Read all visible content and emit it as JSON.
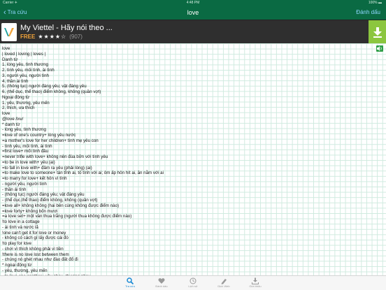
{
  "status_bar": {
    "carrier": "Carrier ✈",
    "time": "4:48 PM",
    "battery": "100% ▬"
  },
  "nav": {
    "back_label": "Tra cứu",
    "title": "love",
    "right_label": "Đánh dấu"
  },
  "ad": {
    "title": "My Viettel - Hãy nói theo ...",
    "free": "FREE",
    "stars": "★★★★☆",
    "count": "(907)"
  },
  "entry_lines": [
    "love",
    "| loved | loving | loves |",
    "Danh từ",
    "1. lòng yêu, tình thương",
    "2. tình yêu, mối tình, ái tình",
    "3. người yêu, người tình",
    "4. thần ái tình",
    "5. (thông tục) người đáng yêu; vật đáng yêu",
    "6. (thể dục, thể thao) điểm không, không (quần vợt)",
    "Ngoại động từ",
    "1. yêu, thương, yêu mến",
    "2. thích, ưa thích",
    "love",
    "@love /lʌv/",
    "* danh từ",
    "- lòng yêu, tình thương",
    "=love of one's country+ lòng yêu nước",
    "=a mother's love for her children+ tình mẹ yêu con",
    "- tình yêu, mối tình, ái tình",
    "=first love+ mối tình đầu",
    "=never trifle with love+ không nên đùa bỡn với tình yêu",
    "=to be in love with+ yêu (ai)",
    "=to fall in love with+ đâm ra yêu (phải lòng) (ai)",
    "=to make love to someone+ tán tỉnh ai, tỏ tình với ai; ôm ấp hôn hít ai, ăn nằm với ai",
    "=to marry for love+ kết hôn vì tình",
    "- người yêu, người tình",
    "- thần ái tình",
    "- (thông tục) người đáng yêu; vật đáng yêu",
    "- (thể dục,thể thao) điểm không, không (quần vợt)",
    "=love all+ không không (hai bên cùng không được điểm nào)",
    "=love forty+ không bốn mươi",
    "=a love set+ một ván thua trắng (người thua không được điểm nào)",
    "!to love in a cottage",
    "- ái tình và nước lã",
    "!one can't get it for love or money",
    "- không có cách gì lấy được cái đó",
    "!to play for love",
    "- chơi vì thích không phải vì tiền",
    "!there is no love lost between them",
    "- chúng nó ghét nhau như đào đất đổ đi",
    "* ngoại động từ",
    "- yêu, thương, yêu mến",
    "=to love one another+ yêu nhau, thương nhau"
  ],
  "tabs": [
    {
      "label": "Tra cứu",
      "icon": "search-icon"
    },
    {
      "label": "Đánh dấu",
      "icon": "heart-icon"
    },
    {
      "label": "Lịch sử",
      "icon": "clock-icon"
    },
    {
      "label": "Dịch Web",
      "icon": "pen-icon"
    },
    {
      "label": "Giới thiệu",
      "icon": "download-tray-icon"
    }
  ],
  "colors": {
    "nav_green": "#0a6a43",
    "link_blue": "#8fd7ff",
    "tab_active": "#1a8ad4",
    "ad_green": "#8cc63f"
  }
}
